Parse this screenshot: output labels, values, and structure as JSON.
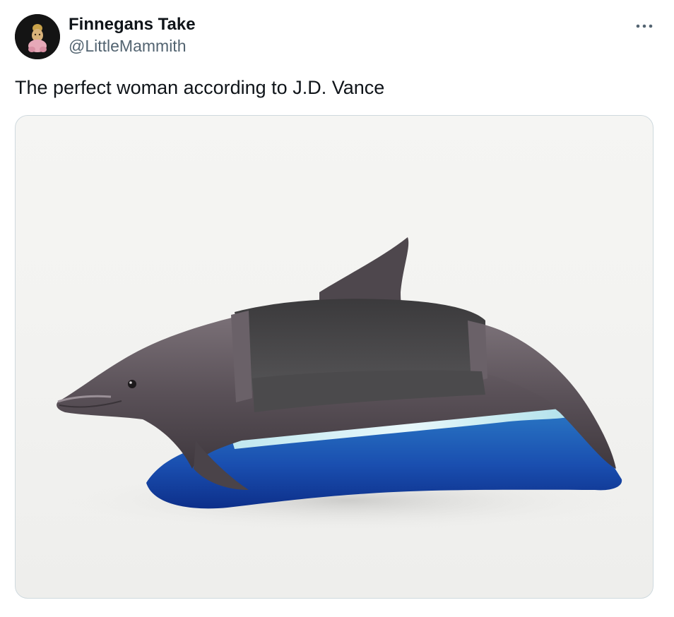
{
  "post": {
    "author": {
      "display_name": "Finnegans Take",
      "handle": "@LittleMammith",
      "avatar_icon": "avatar-image"
    },
    "more_icon": "more-options-icon",
    "text": "The perfect woman according to J.D. Vance",
    "media": {
      "icon": "dolphin-sofa-photo"
    }
  },
  "colors": {
    "text_primary": "#0f1419",
    "text_secondary": "#536471",
    "border": "#cfd9de"
  }
}
